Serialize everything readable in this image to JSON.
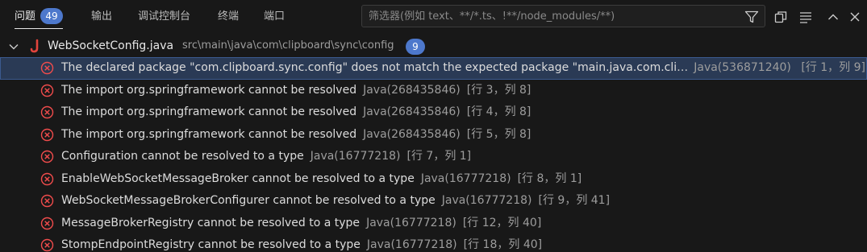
{
  "tabs": [
    {
      "label": "问题",
      "count": "49",
      "active": true
    },
    {
      "label": "输出"
    },
    {
      "label": "调试控制台"
    },
    {
      "label": "终端"
    },
    {
      "label": "端口"
    }
  ],
  "filter": {
    "placeholder": "筛选器(例如 text、**/*.ts、!**/node_modules/**)",
    "value": ""
  },
  "header_icons": [
    "filter-icon",
    "copy-icon",
    "view-as-list-icon",
    "chevron-up-icon",
    "close-icon"
  ],
  "file": {
    "name": "WebSocketConfig.java",
    "path": "src\\main\\java\\com\\clipboard\\sync\\config",
    "count": "9",
    "icon": "java-icon"
  },
  "problems": [
    {
      "message": "The declared package \"com.clipboard.sync.config\" does not match the expected package \"main.java.com.clipboard.sync.config\"",
      "code": "Java(536871240)",
      "position": "[行 1，列 9]",
      "selected": true
    },
    {
      "message": "The import org.springframework cannot be resolved",
      "code": "Java(268435846)",
      "position": "[行 3，列 8]"
    },
    {
      "message": "The import org.springframework cannot be resolved",
      "code": "Java(268435846)",
      "position": "[行 4，列 8]"
    },
    {
      "message": "The import org.springframework cannot be resolved",
      "code": "Java(268435846)",
      "position": "[行 5，列 8]"
    },
    {
      "message": "Configuration cannot be resolved to a type",
      "code": "Java(16777218)",
      "position": "[行 7，列 1]"
    },
    {
      "message": "EnableWebSocketMessageBroker cannot be resolved to a type",
      "code": "Java(16777218)",
      "position": "[行 8，列 1]"
    },
    {
      "message": "WebSocketMessageBrokerConfigurer cannot be resolved to a type",
      "code": "Java(16777218)",
      "position": "[行 9，列 41]"
    },
    {
      "message": "MessageBrokerRegistry cannot be resolved to a type",
      "code": "Java(16777218)",
      "position": "[行 12，列 40]"
    },
    {
      "message": "StompEndpointRegistry cannot be resolved to a type",
      "code": "Java(16777218)",
      "position": "[行 18，列 40]"
    }
  ],
  "colors": {
    "background": "#181818",
    "badge": "#4d78cc",
    "error": "#f14c4c",
    "selection": "#2a3a55"
  }
}
